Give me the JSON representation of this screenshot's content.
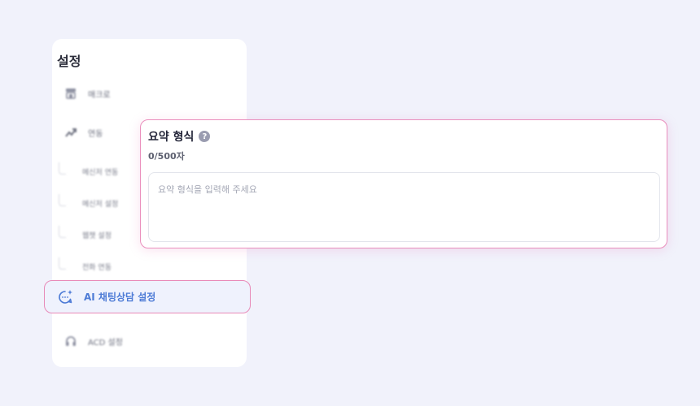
{
  "sidebar": {
    "title": "설정",
    "items": [
      {
        "icon": "store-icon",
        "label": "매크로"
      },
      {
        "icon": "trend-icon",
        "label": "연동"
      }
    ],
    "sub_items": [
      {
        "label": "메신저 연동"
      },
      {
        "label": "메신저 설정"
      },
      {
        "label": "웹챗 설정"
      },
      {
        "label": "전화 연동"
      }
    ],
    "active_item": {
      "icon": "ai-chat-icon",
      "label": "AI 채팅상담 설정"
    },
    "bottom_item": {
      "icon": "headset-icon",
      "label": "ACD 설정"
    }
  },
  "panel": {
    "title": "요약 형식",
    "help_icon": "?",
    "counter": "0/500자",
    "placeholder": "요약 형식을 입력해 주세요"
  },
  "colors": {
    "accent_blue": "#4d7bd6",
    "highlight_pink": "#ea8fbd",
    "background": "#f1f2fb"
  }
}
